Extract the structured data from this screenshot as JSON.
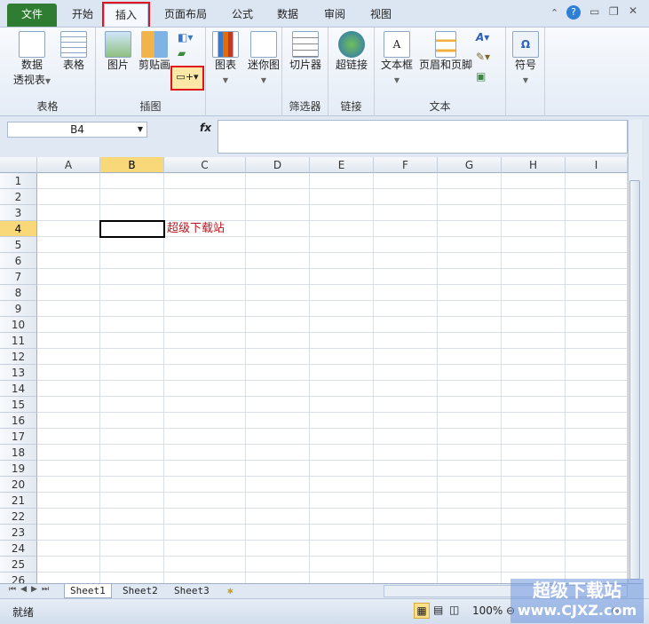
{
  "tabs": {
    "file": "文件",
    "home": "开始",
    "insert": "插入",
    "layout": "页面布局",
    "formulas": "公式",
    "data": "数据",
    "review": "审阅",
    "view": "视图"
  },
  "ribbon": {
    "pivot": "数据",
    "pivot2": "透视表",
    "table": "表格",
    "group_tables": "表格",
    "picture": "图片",
    "clipart": "剪贴画",
    "group_illus": "插图",
    "chart": "图表",
    "sparkline": "迷你图",
    "slicer": "切片器",
    "group_filter": "筛选器",
    "hyperlink": "超链接",
    "group_links": "链接",
    "textbox": "文本框",
    "headerfooter": "页眉和页脚",
    "group_text": "文本",
    "symbol": "符号",
    "omega": "Ω"
  },
  "formula": {
    "namebox": "B4",
    "fx": "fx",
    "value": ""
  },
  "columns": [
    "A",
    "B",
    "C",
    "D",
    "E",
    "F",
    "G",
    "H",
    "I"
  ],
  "rows": [
    "1",
    "2",
    "3",
    "4",
    "5",
    "6",
    "7",
    "8",
    "9",
    "10",
    "11",
    "12",
    "13",
    "14",
    "15",
    "16",
    "17",
    "18",
    "19",
    "20",
    "21",
    "22",
    "23",
    "24",
    "25",
    "26"
  ],
  "cell_C4": "超级下载站",
  "sheets": [
    "Sheet1",
    "Sheet2",
    "Sheet3"
  ],
  "status": {
    "ready": "就绪",
    "zoom": "100%"
  },
  "watermark": {
    "line1": "超级下载站",
    "line2": "www.CJXZ.com"
  }
}
